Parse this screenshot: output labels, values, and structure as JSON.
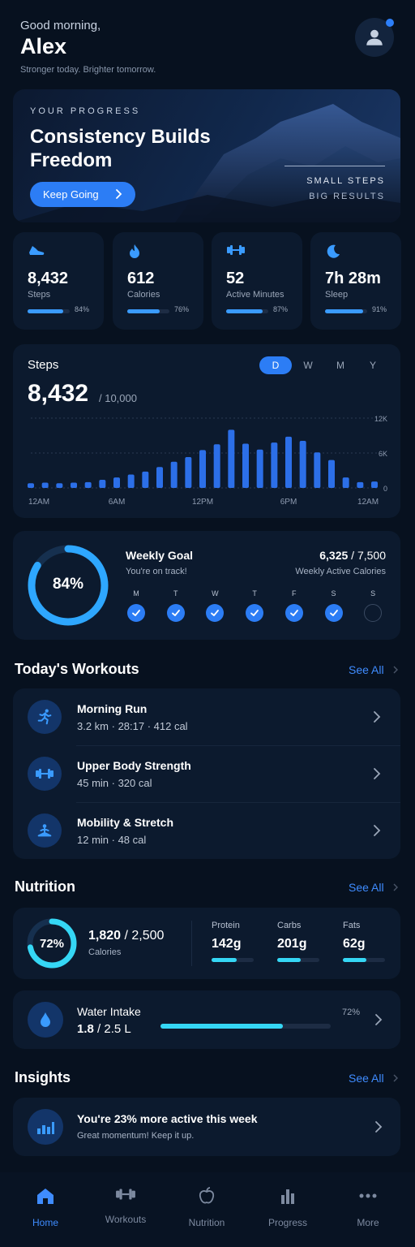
{
  "header": {
    "greeting": "Good morning,",
    "name": "Alex",
    "tagline": "Stronger today. Brighter tomorrow."
  },
  "hero": {
    "eyebrow": "YOUR PROGRESS",
    "title": "Consistency Builds Freedom",
    "button_label": "Keep Going",
    "small_line1": "SMALL STEPS",
    "small_line2": "BIG RESULTS"
  },
  "stats": [
    {
      "icon": "shoe-icon",
      "value": "8,432",
      "label": "Steps",
      "percent": "84%",
      "fraction": 0.84
    },
    {
      "icon": "flame-icon",
      "value": "612",
      "label": "Calories",
      "percent": "76%",
      "fraction": 0.76
    },
    {
      "icon": "dumbbell-icon",
      "value": "52",
      "label": "Active Minutes",
      "percent": "87%",
      "fraction": 0.87
    },
    {
      "icon": "moon-icon",
      "value": "7h 28m",
      "label": "Sleep",
      "percent": "91%",
      "fraction": 0.91
    }
  ],
  "steps_chart": {
    "title": "Steps",
    "total": "8,432",
    "goal": "/ 10,000",
    "periods": [
      "D",
      "W",
      "M",
      "Y"
    ],
    "selected_period": "D",
    "x_labels": [
      "12AM",
      "6AM",
      "12PM",
      "6PM",
      "12AM"
    ],
    "y_labels": [
      "12K",
      "6K",
      "0"
    ]
  },
  "chart_data": {
    "type": "bar",
    "title": "Steps",
    "xlabel": "",
    "ylabel": "",
    "ylim": [
      0,
      12000
    ],
    "categories": [
      "12AM",
      "1AM",
      "2AM",
      "3AM",
      "4AM",
      "5AM",
      "6AM",
      "7AM",
      "8AM",
      "9AM",
      "10AM",
      "11AM",
      "12PM",
      "1PM",
      "2PM",
      "3PM",
      "4PM",
      "5PM",
      "6PM",
      "7PM",
      "8PM",
      "9PM",
      "10PM",
      "11PM",
      "12AM"
    ],
    "values": [
      800,
      900,
      800,
      900,
      1000,
      1400,
      1800,
      2300,
      2800,
      3600,
      4500,
      5300,
      6500,
      7500,
      10000,
      7600,
      6600,
      7800,
      8800,
      8100,
      6100,
      4800,
      1800,
      1000,
      1100
    ],
    "x_tick_labels": [
      "12AM",
      "6AM",
      "12PM",
      "6PM",
      "12AM"
    ],
    "y_tick_labels": [
      "12K",
      "6K",
      "0"
    ]
  },
  "weekly_goal": {
    "ring_percent": "84%",
    "ring_fraction": 0.84,
    "title": "Weekly Goal",
    "subtitle": "You're on track!",
    "value": "6,325",
    "target": "/ 7,500",
    "caption": "Weekly Active Calories",
    "days": [
      {
        "d": "M",
        "done": true
      },
      {
        "d": "T",
        "done": true
      },
      {
        "d": "W",
        "done": true
      },
      {
        "d": "T",
        "done": true
      },
      {
        "d": "F",
        "done": true
      },
      {
        "d": "S",
        "done": true
      },
      {
        "d": "S",
        "done": false
      }
    ]
  },
  "workouts": {
    "title": "Today's Workouts",
    "see_all": "See All",
    "items": [
      {
        "icon": "running-icon",
        "name": "Morning Run",
        "detail": "3.2 km  ·  28:17  ·  412 cal"
      },
      {
        "icon": "dumbbell-icon",
        "name": "Upper Body Strength",
        "detail": "45 min  ·  320 cal"
      },
      {
        "icon": "stretch-icon",
        "name": "Mobility & Stretch",
        "detail": "12 min  ·  48 cal"
      }
    ]
  },
  "nutrition": {
    "title": "Nutrition",
    "see_all": "See All",
    "ring_percent": "72%",
    "ring_fraction": 0.72,
    "calories_value": "1,820",
    "calories_target": "/ 2,500",
    "calories_label": "Calories",
    "macros": [
      {
        "label": "Protein",
        "value": "142g",
        "fraction": 0.6
      },
      {
        "label": "Carbs",
        "value": "201g",
        "fraction": 0.55
      },
      {
        "label": "Fats",
        "value": "62g",
        "fraction": 0.55
      }
    ]
  },
  "water": {
    "title": "Water Intake",
    "value": "1.8",
    "target": "/ 2.5 L",
    "percent": "72%",
    "fraction": 0.72
  },
  "insights": {
    "title": "Insights",
    "see_all": "See All",
    "headline": "You're 23% more active this week",
    "sub": "Great momentum! Keep it up."
  },
  "tabbar": [
    {
      "label": "Home",
      "icon": "home-icon",
      "active": true
    },
    {
      "label": "Workouts",
      "icon": "dumbbell-icon",
      "active": false
    },
    {
      "label": "Nutrition",
      "icon": "apple-icon",
      "active": false
    },
    {
      "label": "Progress",
      "icon": "bar-chart-icon",
      "active": false
    },
    {
      "label": "More",
      "icon": "more-icon",
      "active": false
    }
  ],
  "colors": {
    "background": "#07111f",
    "card": "#0c1a2e",
    "accent": "#2c7df5",
    "cyan": "#35d7f5"
  }
}
